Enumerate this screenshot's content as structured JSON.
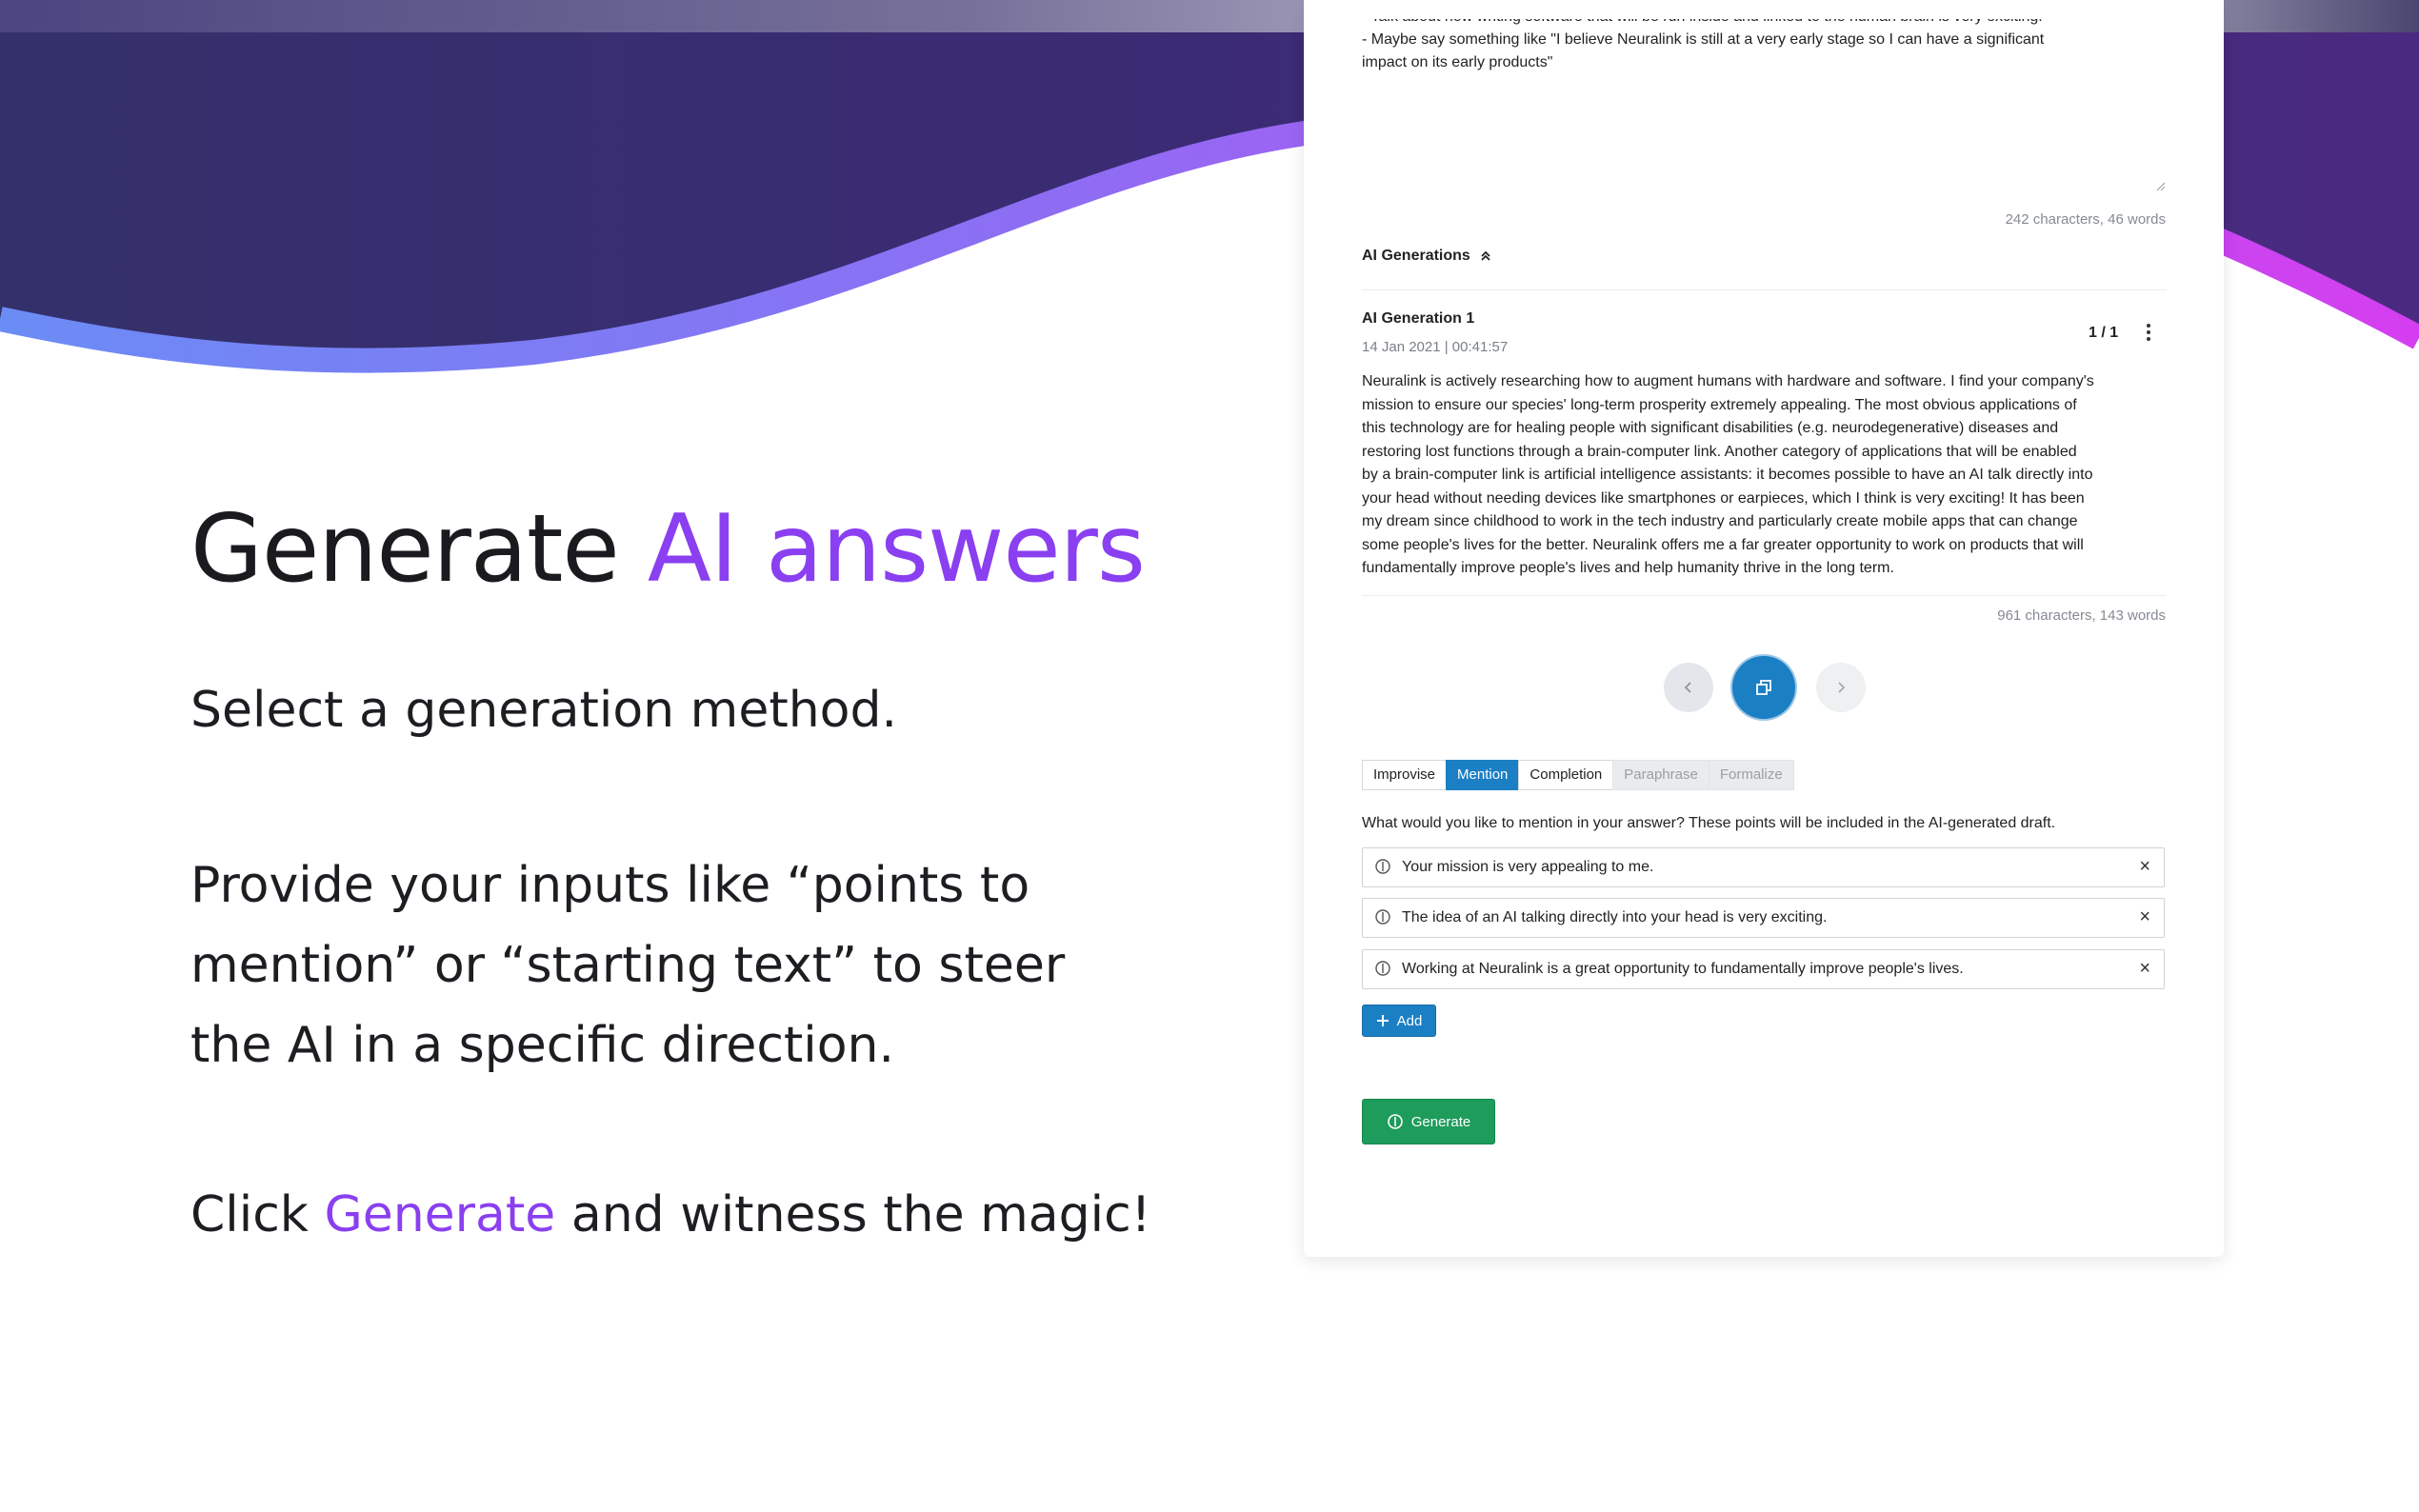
{
  "hero": {
    "headline_plain": "Generate ",
    "headline_accent": "AI answers",
    "paragraph1": "Select a generation method.",
    "paragraph2": "Provide your inputs like “points to mention” or “starting text” to steer the AI in a specific direction.",
    "paragraph3_before": "Click ",
    "paragraph3_accent": "Generate",
    "paragraph3_after": " and witness the magic!"
  },
  "app": {
    "prompt_lines": [
      "- Talk about how writing software that will be run inside and linked to the human brain is very exciting.",
      "- Maybe say something like \"I believe Neuralink is still at a very early stage so I can have a significant",
      "impact on its early products\""
    ],
    "prompt_counter": "242 characters, 46 words",
    "section_label": "AI Generations",
    "generation": {
      "title": "AI Generation 1",
      "date": "14 Jan 2021 | 00:41:57",
      "pager": "1 / 1",
      "lines": [
        "Neuralink is actively researching how to augment humans with hardware and software. I find your company's",
        "mission to ensure our species' long-term prosperity extremely appealing. The most obvious applications of",
        "this technology are for healing people with significant disabilities (e.g. neurodegenerative) diseases and",
        "restoring lost functions through a brain-computer link. Another category of applications that will be enabled",
        "by a brain-computer link is artificial intelligence assistants: it becomes possible to have an AI talk directly into",
        "your head without needing devices like smartphones or earpieces, which I think is very exciting! It has been",
        "my dream since childhood to work in the tech industry and particularly create mobile apps that can change",
        "some people's lives for the better. Neuralink offers me a far greater opportunity to work on products that will",
        "fundamentally improve people's lives and help humanity thrive in the long term."
      ],
      "counter": "961 characters, 143 words"
    },
    "tabs": [
      {
        "label": "Improvise",
        "state": "normal"
      },
      {
        "label": "Mention",
        "state": "active"
      },
      {
        "label": "Completion",
        "state": "normal"
      },
      {
        "label": "Paraphrase",
        "state": "disabled"
      },
      {
        "label": "Formalize",
        "state": "disabled"
      }
    ],
    "mention_hint": "What would you like to mention in your answer? These points will be included in the AI-generated draft.",
    "mentions": [
      "Your mission is very appealing to me.",
      "The idea of an AI talking directly into your head is very exciting.",
      "Working at Neuralink is a great opportunity to fundamentally improve people's lives."
    ],
    "add_label": "Add",
    "generate_label": "Generate",
    "close_glyph": "×"
  },
  "colors": {
    "accent_purple": "#8a3ff0",
    "primary_blue": "#1b7fc4",
    "generate_green": "#1d9c5b",
    "wave_dark": "#372c6e"
  }
}
